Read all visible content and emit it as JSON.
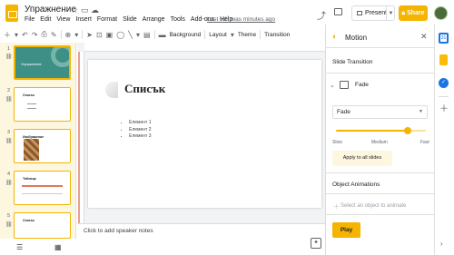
{
  "title_bar": {
    "doc_title": "Упражнение",
    "star_icon": "star-icon",
    "folder_icon": "folder-icon",
    "cloud_icon": "cloud-icon",
    "last_edit": "Last edit was minutes ago",
    "present_label": "Present",
    "share_label": "Share"
  },
  "menu": [
    "File",
    "Edit",
    "View",
    "Insert",
    "Format",
    "Slide",
    "Arrange",
    "Tools",
    "Add-ons",
    "Help"
  ],
  "toolbar": {
    "background_label": "Background",
    "layout_label": "Layout",
    "theme_label": "Theme",
    "transition_label": "Transition"
  },
  "filmstrip": {
    "slides": [
      {
        "num": "1",
        "title": "Упражнение"
      },
      {
        "num": "2",
        "title": "Списък"
      },
      {
        "num": "3",
        "title": "Изображение"
      },
      {
        "num": "4",
        "title": "Таблица"
      },
      {
        "num": "5",
        "title": "Списък"
      }
    ]
  },
  "slide": {
    "title": "Списък",
    "items": [
      "Елемент 1",
      "Елемент 2",
      "Елемент 3"
    ]
  },
  "notes": {
    "placeholder": "Click to add speaker notes"
  },
  "motion_panel": {
    "title": "Motion",
    "slide_transition_label": "Slide Transition",
    "transition_name": "Fade",
    "selected_effect": "Fade",
    "speed": {
      "slow": "Slow",
      "medium": "Medium",
      "fast": "Fast",
      "level": 0.8
    },
    "apply_all_label": "Apply to all slides",
    "object_animations_label": "Object Animations",
    "select_object_text": "Select an object to animate",
    "play_label": "Play"
  },
  "side_rail": {
    "calendar_label": "31"
  },
  "colors": {
    "accent": "#f4b400",
    "filmstrip_bg": "#fef7e0",
    "theme_slide": "#3e8f85"
  }
}
